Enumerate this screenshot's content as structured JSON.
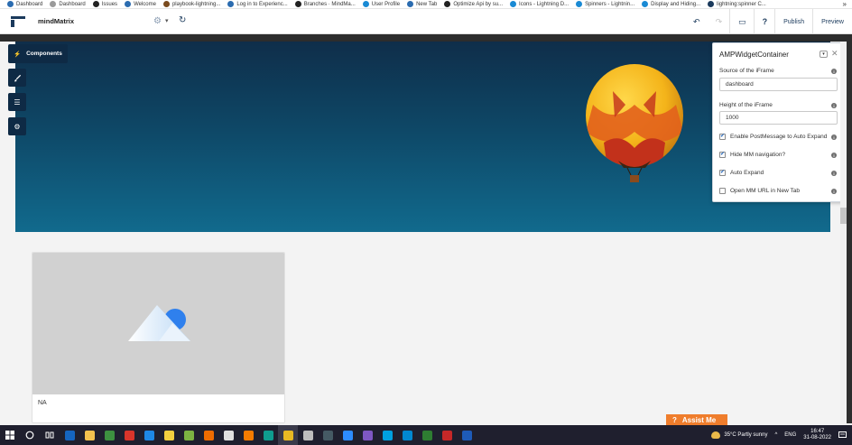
{
  "bookmarks": [
    {
      "label": "Dashboard",
      "color": "#2b6cb0"
    },
    {
      "label": "Dashboard",
      "color": "#9a9a9a"
    },
    {
      "label": "Issues",
      "color": "#222222"
    },
    {
      "label": "Welcome",
      "color": "#2b6cb0"
    },
    {
      "label": "playbook-lightning...",
      "color": "#7a4b1e"
    },
    {
      "label": "Log in to Experienc...",
      "color": "#2b6cb0"
    },
    {
      "label": "Branches · MindMa...",
      "color": "#222222"
    },
    {
      "label": "User Profile",
      "color": "#1a8ad4"
    },
    {
      "label": "New Tab",
      "color": "#2b6cb0"
    },
    {
      "label": "Optimize Api by su...",
      "color": "#222222"
    },
    {
      "label": "Icons - Lightning D...",
      "color": "#1a8ad4"
    },
    {
      "label": "Spinners - Lightnin...",
      "color": "#1a8ad4"
    },
    {
      "label": "Display and Hiding...",
      "color": "#1a8ad4"
    },
    {
      "label": "lightning:spinner C...",
      "color": "#1b3a5c"
    }
  ],
  "bookmarks_more": "»",
  "toolbar": {
    "title": "mindMatrix",
    "gear": "⚙",
    "caret": "▾",
    "refresh": "↻",
    "undo": "↶",
    "redo": "↷",
    "device": "▭",
    "help": "?",
    "publish": "Publish",
    "preview": "Preview"
  },
  "sidebar": {
    "components_label": "Components",
    "components_icon": "⚡",
    "brush_icon": "🖌",
    "list_icon": "☰",
    "settings_icon": "⚙"
  },
  "panel": {
    "title": "AMPWidgetContainer",
    "menu_icon": "▾",
    "close_icon": "✕",
    "source_label": "Source of the iFrame",
    "source_value": "dashboard",
    "height_label": "Height of the iFrame",
    "height_value": "1000",
    "info_glyph": "i",
    "checkboxes": [
      {
        "label": "Enable PostMessage to Auto Expand",
        "checked": true
      },
      {
        "label": "Hide MM navigation?",
        "checked": true
      },
      {
        "label": "Auto Expand",
        "checked": true
      },
      {
        "label": "Open MM URL in New Tab",
        "checked": false
      }
    ],
    "check_glyph": "✔"
  },
  "card": {
    "label": "NA"
  },
  "assist": {
    "icon": "?",
    "label": "Assist Me"
  },
  "taskbar": {
    "weather": "35°C  Partly sunny",
    "chevron": "^",
    "lang": "ENG",
    "time": "16:47",
    "date": "31-08-2022",
    "apps": [
      {
        "name": "outlook",
        "color": "#1565c0"
      },
      {
        "name": "files",
        "color": "#f2c14e"
      },
      {
        "name": "notepad",
        "color": "#3d9140"
      },
      {
        "name": "media",
        "color": "#d9352b"
      },
      {
        "name": "vscode",
        "color": "#1e88e5"
      },
      {
        "name": "sticky",
        "color": "#f4d03f"
      },
      {
        "name": "android",
        "color": "#7cb342"
      },
      {
        "name": "postman",
        "color": "#ef6c00"
      },
      {
        "name": "github",
        "color": "#e0e0e0"
      },
      {
        "name": "pencil",
        "color": "#f57c00"
      },
      {
        "name": "edge",
        "color": "#0f9d8f"
      },
      {
        "name": "chrome",
        "color": "#e8b923"
      },
      {
        "name": "chrome-dev",
        "color": "#bdbdbd"
      },
      {
        "name": "team",
        "color": "#455a64"
      },
      {
        "name": "zoom",
        "color": "#2d8cff"
      },
      {
        "name": "vs",
        "color": "#7e57c2"
      },
      {
        "name": "salesforce",
        "color": "#00a1e0"
      },
      {
        "name": "skype",
        "color": "#0288d1"
      },
      {
        "name": "excel",
        "color": "#2e7d32"
      },
      {
        "name": "filezilla",
        "color": "#c62828"
      },
      {
        "name": "word",
        "color": "#1e5bb8"
      }
    ]
  }
}
